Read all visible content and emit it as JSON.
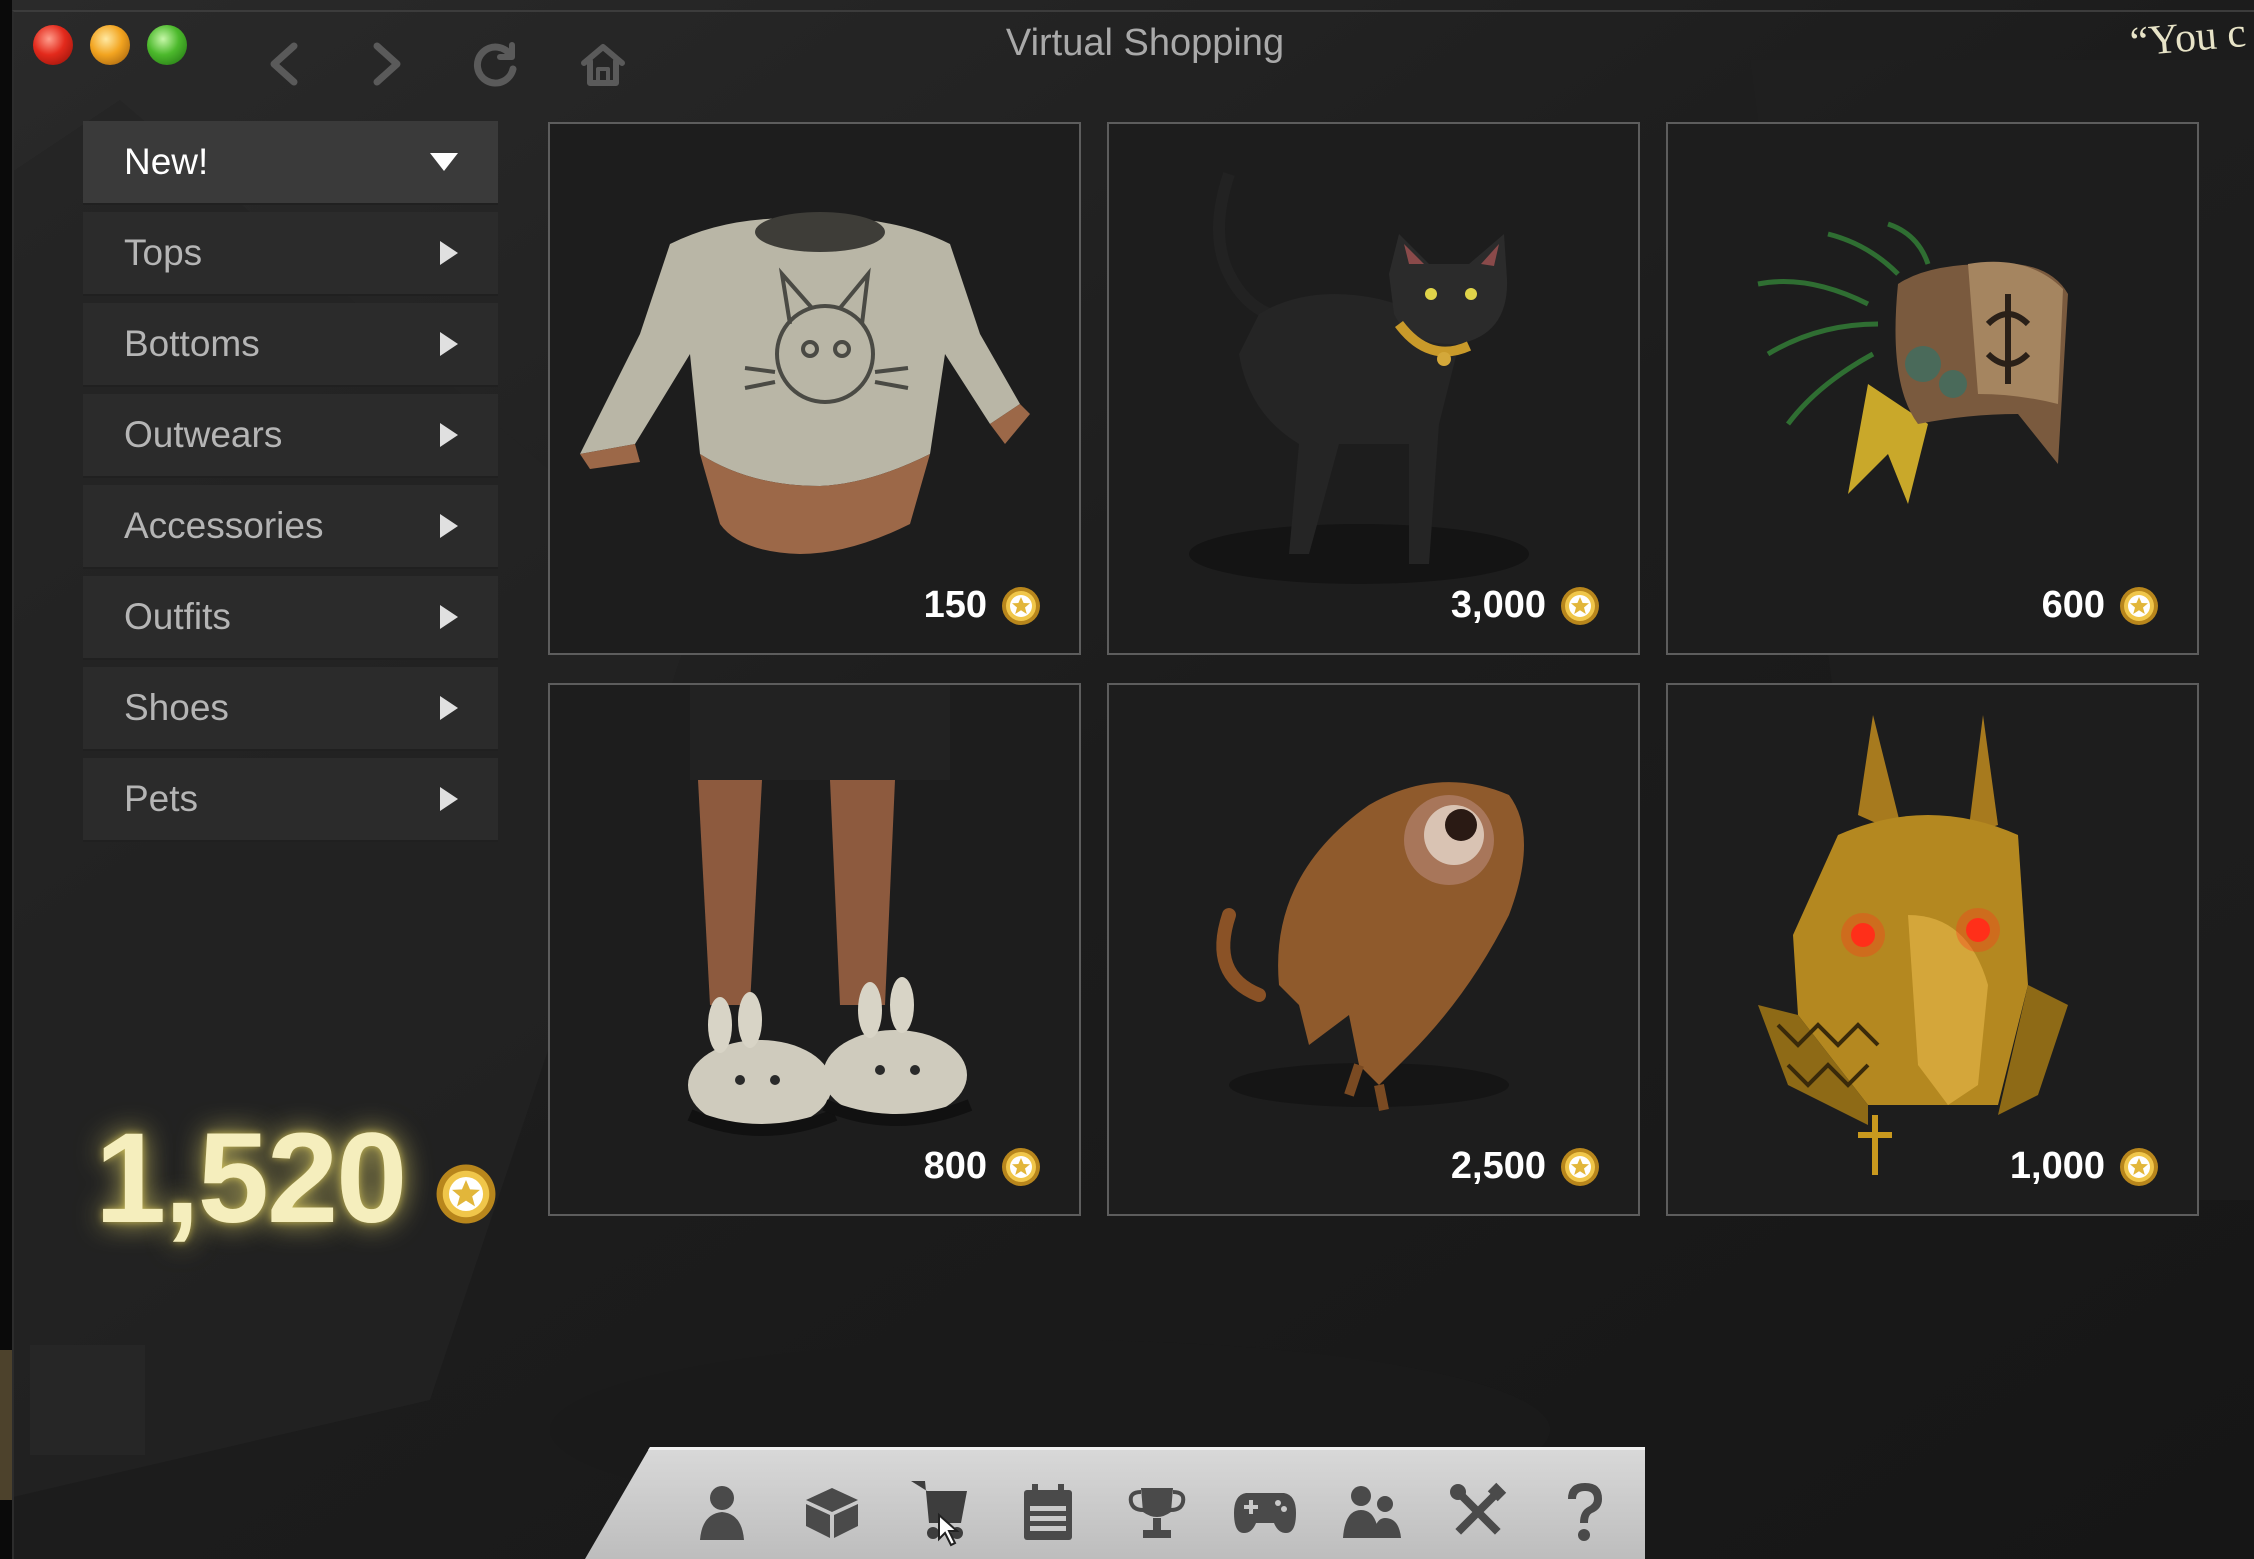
{
  "window": {
    "title": "Virtual Shopping",
    "quote_fragment": "“You c"
  },
  "colors": {
    "background": "#1b1b1b",
    "card_border": "#5d5d5d",
    "sidebar_item": "#2b2b2b",
    "sidebar_active": "#3a3a3a",
    "balance_glow": "#f5eebd",
    "coin_gold": "#e2b63a",
    "toolbar": "#c9c9c9"
  },
  "categories": [
    {
      "label": "New!",
      "active": true,
      "indicator": "chevron-down-icon"
    },
    {
      "label": "Tops",
      "indicator": "chevron-right-icon"
    },
    {
      "label": "Bottoms",
      "indicator": "chevron-right-icon"
    },
    {
      "label": "Outwears",
      "indicator": "chevron-right-icon"
    },
    {
      "label": "Accessories",
      "indicator": "chevron-right-icon"
    },
    {
      "label": "Outfits",
      "indicator": "chevron-right-icon"
    },
    {
      "label": "Shoes",
      "indicator": "chevron-right-icon"
    },
    {
      "label": "Pets",
      "indicator": "chevron-right-icon"
    }
  ],
  "balance": {
    "value": "1,520",
    "currency_icon": "coin-icon"
  },
  "products": [
    {
      "price": "150",
      "image": "cat-tshirt"
    },
    {
      "price": "3,000",
      "image": "black-cat-pet"
    },
    {
      "price": "600",
      "image": "feathered-headdress"
    },
    {
      "price": "800",
      "image": "bunny-slippers"
    },
    {
      "price": "2,500",
      "image": "eyeball-creature-pet"
    },
    {
      "price": "1,000",
      "image": "anubis-mask"
    }
  ],
  "toolbar": {
    "items": [
      {
        "icon": "profile-icon"
      },
      {
        "icon": "inventory-box-icon"
      },
      {
        "icon": "shopping-cart-icon",
        "active": true
      },
      {
        "icon": "calendar-icon"
      },
      {
        "icon": "trophy-icon"
      },
      {
        "icon": "gamepad-icon"
      },
      {
        "icon": "friends-icon"
      },
      {
        "icon": "tools-icon"
      },
      {
        "icon": "help-icon"
      }
    ]
  }
}
